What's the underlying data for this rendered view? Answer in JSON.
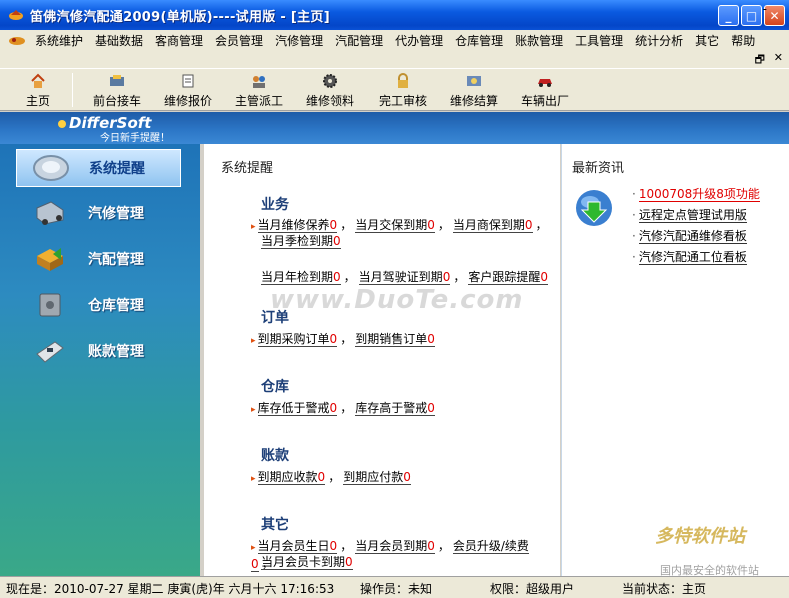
{
  "window": {
    "title": "笛佛汽修汽配通2009(单机版)----试用版 - [主页]",
    "minimize": "_",
    "maximize": "□",
    "close": "✕"
  },
  "menu": [
    "系统维护",
    "基础数据",
    "客商管理",
    "会员管理",
    "汽修管理",
    "汽配管理",
    "代办管理",
    "仓库管理",
    "账款管理",
    "工具管理",
    "统计分析",
    "其它",
    "帮助"
  ],
  "menu_dash": "-",
  "subbar": {
    "restore": "🗗",
    "close": "✕"
  },
  "toolbar": [
    {
      "label": "主页",
      "icon": "home-icon"
    },
    {
      "label": "前台接车",
      "icon": "reception-icon"
    },
    {
      "label": "维修报价",
      "icon": "quote-icon"
    },
    {
      "label": "主管派工",
      "icon": "dispatch-icon"
    },
    {
      "label": "维修领料",
      "icon": "gear-icon"
    },
    {
      "label": "完工审核",
      "icon": "lock-icon"
    },
    {
      "label": "维修结算",
      "icon": "settlement-icon"
    },
    {
      "label": "车辆出厂",
      "icon": "car-icon"
    }
  ],
  "brand": {
    "name": "DifferSoft",
    "sub": "今日新手提醒！"
  },
  "sidebar": [
    {
      "label": "系统提醒",
      "icon": "bell-icon",
      "active": true
    },
    {
      "label": "汽修管理",
      "icon": "truck-icon"
    },
    {
      "label": "汽配管理",
      "icon": "parts-icon"
    },
    {
      "label": "仓库管理",
      "icon": "warehouse-icon"
    },
    {
      "label": "账款管理",
      "icon": "pos-icon"
    }
  ],
  "main": {
    "title": "系统提醒",
    "sections": {
      "business": {
        "title": "业务",
        "row1": [
          {
            "label": "当月维修保养",
            "count": "0"
          },
          {
            "label": "当月交保到期",
            "count": "0"
          },
          {
            "label": "当月商保到期",
            "count": "0"
          }
        ],
        "row1b": [
          {
            "label": "当月季检到期",
            "count": "0"
          }
        ],
        "row2": [
          {
            "label": "当月年检到期",
            "count": "0"
          },
          {
            "label": "当月驾驶证到期",
            "count": "0"
          },
          {
            "label": "客户跟踪提醒",
            "count": "0"
          }
        ]
      },
      "order": {
        "title": "订单",
        "row": [
          {
            "label": "到期采购订单",
            "count": "0"
          },
          {
            "label": "到期销售订单",
            "count": "0"
          }
        ]
      },
      "warehouse": {
        "title": "仓库",
        "row": [
          {
            "label": "库存低于警戒",
            "count": "0"
          },
          {
            "label": "库存高于警戒",
            "count": "0"
          }
        ]
      },
      "account": {
        "title": "账款",
        "row": [
          {
            "label": "到期应收款",
            "count": "0"
          },
          {
            "label": "到期应付款",
            "count": "0"
          }
        ]
      },
      "other": {
        "title": "其它",
        "row1": [
          {
            "label": "当月会员生日",
            "count": "0"
          },
          {
            "label": "当月会员到期",
            "count": "0"
          },
          {
            "label": "会员升级/续费",
            "count": "0"
          }
        ],
        "row1b": [
          {
            "label": "当月会员卡到期",
            "count": "0"
          }
        ]
      }
    },
    "comma": "，"
  },
  "news": {
    "title": "最新资讯",
    "items": [
      {
        "label": "1000708升级8项功能",
        "hot": true
      },
      {
        "label": "远程定点管理试用版"
      },
      {
        "label": "汽修汽配通维修看板"
      },
      {
        "label": "汽修汽配通工位看板"
      }
    ]
  },
  "watermark": {
    "main": "www.DuoTe.com",
    "corner_title": "多特软件站",
    "corner_sub": "国内最安全的软件站"
  },
  "status": {
    "time": "现在是：2010-07-27 星期二 庚寅(虎)年 六月十六 17:16:53",
    "operator": "操作员：未知",
    "permission": "权限：超级用户",
    "state": "当前状态：主页"
  },
  "colors": {
    "accent": "#1e5ba8",
    "alert": "#e00000",
    "title_blue": "#0a52d6"
  }
}
